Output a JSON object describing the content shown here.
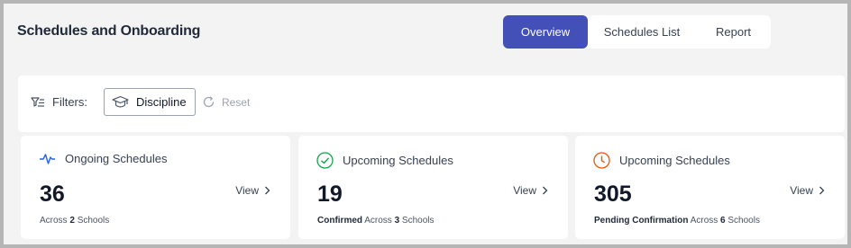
{
  "header": {
    "title": "Schedules and Onboarding",
    "tabs": [
      "Overview",
      "Schedules List",
      "Report"
    ]
  },
  "filters": {
    "label": "Filters:",
    "discipline": "Discipline",
    "reset": "Reset"
  },
  "cards": [
    {
      "title": "Ongoing Schedules",
      "value": "36",
      "view": "View",
      "sub_strong": "",
      "sub_text": "Across",
      "sub_count": "2",
      "sub_tail": "Schools",
      "icon": "activity-icon",
      "icon_color": "#2563eb"
    },
    {
      "title": "Upcoming Schedules",
      "value": "19",
      "view": "View",
      "sub_strong": "Confirmed",
      "sub_text": "Across",
      "sub_count": "3",
      "sub_tail": "Schools",
      "icon": "check-circle-icon",
      "icon_color": "#16a34a"
    },
    {
      "title": "Upcoming Schedules",
      "value": "305",
      "view": "View",
      "sub_strong": "Pending Confirmation",
      "sub_text": "Across",
      "sub_count": "6",
      "sub_tail": "Schools",
      "icon": "clock-icon",
      "icon_color": "#ea580c"
    }
  ],
  "colors": {
    "accent": "#4350b7",
    "background": "#f3f3f3"
  }
}
